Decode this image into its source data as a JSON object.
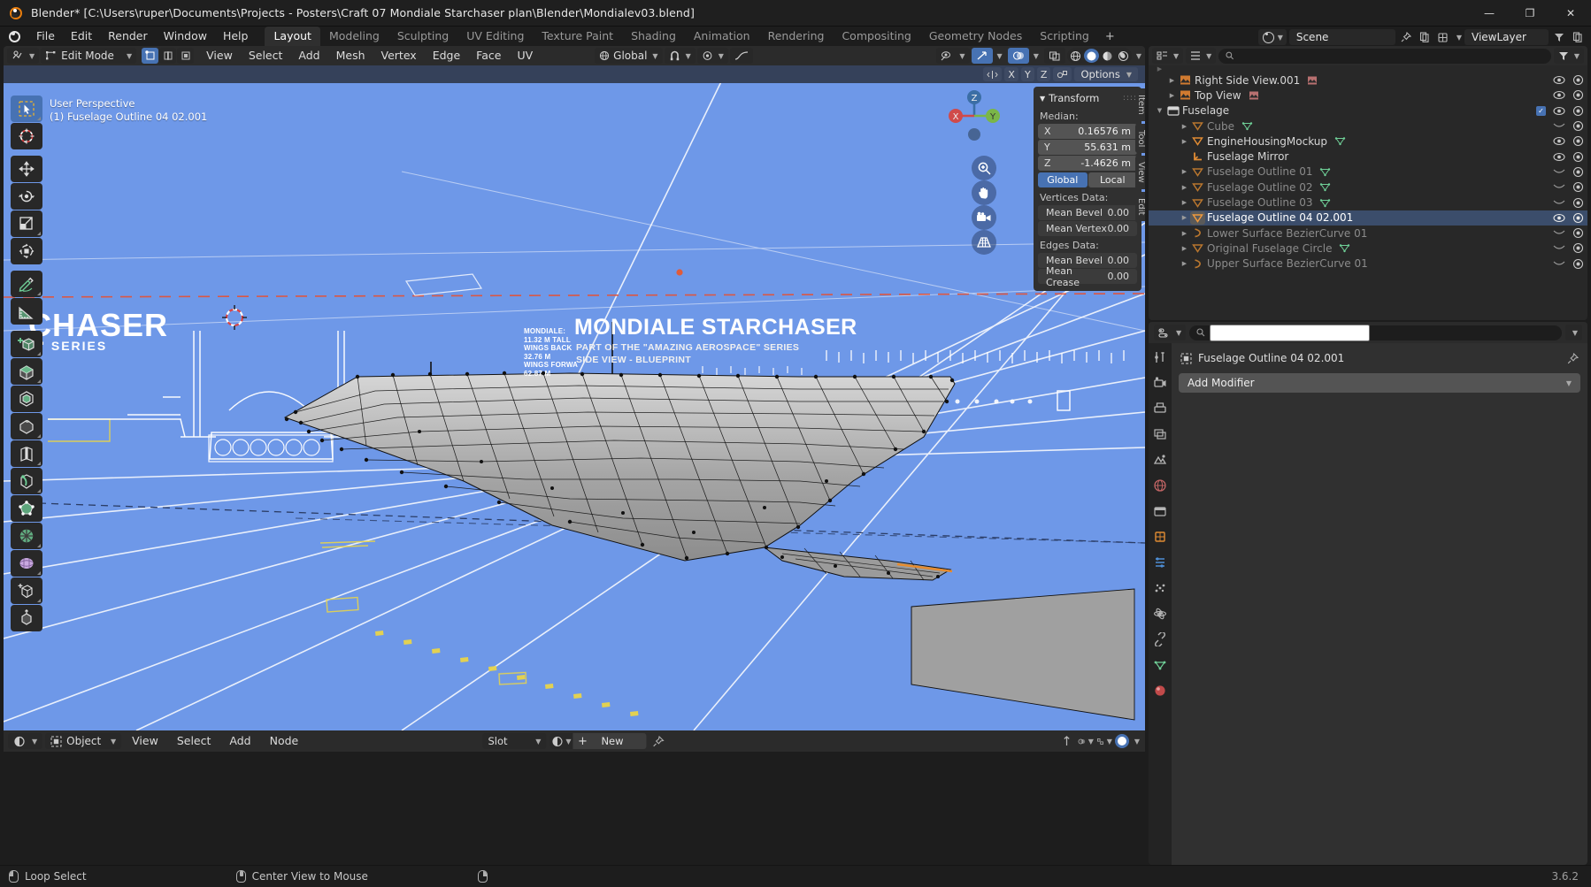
{
  "window": {
    "title": "Blender* [C:\\Users\\ruper\\Documents\\Projects - Posters\\Craft 07 Mondiale Starchaser plan\\Blender\\Mondialev03.blend]",
    "minimize": "—",
    "maximize": "❐",
    "close": "✕"
  },
  "topbar": {
    "menus": [
      "File",
      "Edit",
      "Render",
      "Window",
      "Help"
    ],
    "workspaces": [
      {
        "label": "Layout",
        "active": true
      },
      {
        "label": "Modeling",
        "active": false
      },
      {
        "label": "Sculpting",
        "active": false
      },
      {
        "label": "UV Editing",
        "active": false
      },
      {
        "label": "Texture Paint",
        "active": false
      },
      {
        "label": "Shading",
        "active": false
      },
      {
        "label": "Animation",
        "active": false
      },
      {
        "label": "Rendering",
        "active": false
      },
      {
        "label": "Compositing",
        "active": false
      },
      {
        "label": "Geometry Nodes",
        "active": false
      },
      {
        "label": "Scripting",
        "active": false
      }
    ],
    "add_workspace": "+",
    "scene_name": "Scene",
    "view_layer_name": "ViewLayer"
  },
  "viewport_header": {
    "editor_type_icon": "editor-type-icon",
    "mode": "Edit Mode",
    "select_modes": [
      {
        "name": "vertex-select",
        "active": true
      },
      {
        "name": "edge-select",
        "active": false
      },
      {
        "name": "face-select",
        "active": false
      }
    ],
    "menus": [
      "View",
      "Select",
      "Add",
      "Mesh",
      "Vertex",
      "Edge",
      "Face",
      "UV"
    ],
    "transform_orientation": "Global",
    "options_label": "Options",
    "proportional_axes": [
      "X",
      "Y",
      "Z"
    ]
  },
  "viewport": {
    "overlay_line1": "User Perspective",
    "overlay_line2": "(1) Fuselage Outline 04 02.001",
    "gizmo_axes": {
      "x": "X",
      "y": "Y",
      "z": "Z"
    },
    "background_color": "#6e98e8",
    "blueprint": {
      "title_left_partial": "CHASER",
      "subtitle_left_partial": "E\" SERIES",
      "title_main": "MONDIALE STARCHASER",
      "subtitle_main": "PART OF THE \"AMAZING AEROSPACE\" SERIES",
      "subtitle_main2": "SIDE VIEW - BLUEPRINT",
      "spec_lines": [
        "MONDIALE:",
        "11.32 M TALL",
        "WINGS BACK",
        "32.76 M",
        "WINGS FORWA",
        "62.87 M"
      ]
    }
  },
  "outliner": {
    "search_placeholder": "",
    "items": [
      {
        "name": "Right Side View.001",
        "indent": 1,
        "icon": "image-icon",
        "expand": true,
        "dim": false,
        "data_icon": "image-data-icon",
        "selected": false,
        "visible": true
      },
      {
        "name": "Top View",
        "indent": 1,
        "icon": "image-icon",
        "expand": true,
        "dim": false,
        "data_icon": "image-data-icon",
        "selected": false,
        "visible": true
      },
      {
        "name": "Fuselage",
        "indent": 0,
        "icon": "collection-icon",
        "expand": true,
        "expanded": true,
        "dim": false,
        "checkbox": true,
        "selected": false,
        "visible": true
      },
      {
        "name": "Cube",
        "indent": 2,
        "icon": "mesh-object-icon",
        "expand": true,
        "dim": true,
        "data_icon": "mesh-data-icon",
        "selected": false,
        "visible": false
      },
      {
        "name": "EngineHousingMockup",
        "indent": 2,
        "icon": "mesh-object-icon",
        "expand": true,
        "dim": false,
        "data_icon": "mesh-data-icon",
        "selected": false,
        "visible": true
      },
      {
        "name": "Fuselage Mirror",
        "indent": 2,
        "icon": "empty-axes-icon",
        "expand": false,
        "dim": false,
        "selected": false,
        "visible": true
      },
      {
        "name": "Fuselage Outline 01",
        "indent": 2,
        "icon": "mesh-object-icon",
        "expand": true,
        "dim": true,
        "data_icon": "mesh-data-icon",
        "selected": false,
        "visible": false
      },
      {
        "name": "Fuselage Outline 02",
        "indent": 2,
        "icon": "mesh-object-icon",
        "expand": true,
        "dim": true,
        "data_icon": "mesh-data-icon",
        "selected": false,
        "visible": false
      },
      {
        "name": "Fuselage Outline 03",
        "indent": 2,
        "icon": "mesh-object-icon",
        "expand": true,
        "dim": true,
        "data_icon": "mesh-data-icon",
        "selected": false,
        "visible": false
      },
      {
        "name": "Fuselage Outline 04 02.001",
        "indent": 2,
        "icon": "mesh-object-icon",
        "expand": true,
        "dim": false,
        "selected": true,
        "visible": true
      },
      {
        "name": "Lower Surface BezierCurve 01",
        "indent": 2,
        "icon": "curve-icon",
        "expand": true,
        "dim": true,
        "selected": false,
        "visible": false
      },
      {
        "name": "Original Fuselage Circle",
        "indent": 2,
        "icon": "mesh-object-icon",
        "expand": true,
        "dim": true,
        "data_icon": "mesh-data-icon",
        "selected": false,
        "visible": false
      },
      {
        "name": "Upper Surface BezierCurve 01",
        "indent": 2,
        "icon": "curve-icon",
        "expand": true,
        "dim": true,
        "selected": false,
        "visible": false
      }
    ]
  },
  "transform_panel": {
    "title": "Transform",
    "median_label": "Median:",
    "median": [
      {
        "axis": "X",
        "value": "0.16576 m"
      },
      {
        "axis": "Y",
        "value": "55.631 m"
      },
      {
        "axis": "Z",
        "value": "-1.4626 m"
      }
    ],
    "space_toggle": [
      {
        "label": "Global",
        "active": true
      },
      {
        "label": "Local",
        "active": false
      }
    ],
    "vertices_label": "Vertices Data:",
    "vertices_fields": [
      {
        "label": "Mean Bevel",
        "value": "0.00"
      },
      {
        "label": "Mean Vertex",
        "value": "0.00"
      }
    ],
    "edges_label": "Edges Data:",
    "edges_fields": [
      {
        "label": "Mean Bevel",
        "value": "0.00"
      },
      {
        "label": "Mean Crease",
        "value": "0.00"
      }
    ],
    "side_tabs": [
      "Item",
      "Tool",
      "View",
      "Edit"
    ]
  },
  "properties": {
    "search_placeholder": "",
    "breadcrumb_object": "Fuselage Outline 04 02.001",
    "add_modifier": "Add Modifier",
    "tabs": [
      "tool-properties-tab",
      "render-properties-tab",
      "output-properties-tab",
      "view-layer-properties-tab",
      "scene-properties-tab",
      "world-properties-tab",
      "collection-properties-tab",
      "object-properties-tab",
      "modifier-properties-tab",
      "particle-properties-tab",
      "physics-properties-tab",
      "constraint-properties-tab",
      "object-data-properties-tab",
      "material-properties-tab"
    ]
  },
  "shader_editor": {
    "mode": "Object",
    "menus": [
      "View",
      "Select",
      "Add",
      "Node"
    ],
    "slot_label": "Slot",
    "new_label": "New",
    "add_icon": "+"
  },
  "statusbar": {
    "hints": [
      {
        "mouse": "left",
        "label": "Loop Select"
      },
      {
        "mouse": "middle",
        "label": "Center View to Mouse"
      },
      {
        "mouse": "right",
        "label": ""
      }
    ],
    "version": "3.6.2"
  }
}
